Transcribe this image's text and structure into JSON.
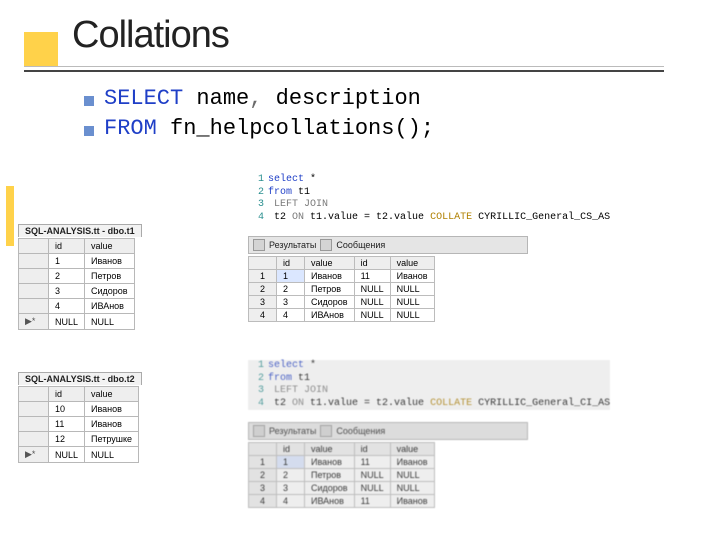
{
  "title": "Collations",
  "code": {
    "l1_kw": "SELECT",
    "l1_rest": " name",
    "l1_punct": ",",
    "l1_desc": " description",
    "l2_kw": "FROM",
    "l2_rest": " fn_helpcollations();"
  },
  "table1": {
    "tab": "SQL-ANALYSIS.tt - dbo.t1",
    "cols": [
      "id",
      "value"
    ],
    "rows": [
      [
        "1",
        "Иванов"
      ],
      [
        "2",
        "Петров"
      ],
      [
        "3",
        "Сидоров"
      ],
      [
        "4",
        "ИВАнов"
      ],
      [
        "NULL",
        "NULL"
      ]
    ],
    "star": "▶*"
  },
  "table2": {
    "tab": "SQL-ANALYSIS.tt - dbo.t2",
    "cols": [
      "id",
      "value"
    ],
    "rows": [
      [
        "10",
        "Иванов"
      ],
      [
        "11",
        "Иванов"
      ],
      [
        "12",
        "Петрушке"
      ],
      [
        "NULL",
        "NULL"
      ]
    ],
    "star": "▶*"
  },
  "sql1": {
    "lines": [
      {
        "ln": "1",
        "a": "select",
        "b": " *"
      },
      {
        "ln": "2",
        "a": "from",
        "b": " t1"
      },
      {
        "ln": "3",
        "a": "    LEFT JOIN",
        "b": ""
      },
      {
        "ln": "4",
        "a": "    t2 ",
        "b": "ON",
        "c": " t1.value = t2.value ",
        "d": "COLLATE",
        "e": " CYRILLIC_General_CS_AS"
      }
    ]
  },
  "resultTabs": {
    "a": "Результаты",
    "b": "Сообщения"
  },
  "result1": {
    "cols": [
      "id",
      "value",
      "id",
      "value"
    ],
    "rows": [
      [
        "1",
        "1",
        "Иванов",
        "11",
        "Иванов"
      ],
      [
        "2",
        "2",
        "Петров",
        "NULL",
        "NULL"
      ],
      [
        "3",
        "3",
        "Сидоров",
        "NULL",
        "NULL"
      ],
      [
        "4",
        "4",
        "ИВАнов",
        "NULL",
        "NULL"
      ]
    ]
  },
  "sql2": {
    "lines": [
      {
        "ln": "1",
        "a": "select",
        "b": " *"
      },
      {
        "ln": "2",
        "a": "from",
        "b": " t1"
      },
      {
        "ln": "3",
        "a": "    LEFT JOIN",
        "b": ""
      },
      {
        "ln": "4",
        "a": "    t2 ",
        "b": "ON",
        "c": " t1.value = t2.value ",
        "d": "COLLATE",
        "e": " CYRILLIC_General_CI_AS"
      }
    ]
  },
  "result2": {
    "cols": [
      "id",
      "value",
      "id",
      "value"
    ],
    "rows": [
      [
        "1",
        "1",
        "Иванов",
        "11",
        "Иванов"
      ],
      [
        "2",
        "2",
        "Петров",
        "NULL",
        "NULL"
      ],
      [
        "3",
        "3",
        "Сидоров",
        "NULL",
        "NULL"
      ],
      [
        "4",
        "4",
        "ИВАнов",
        "11",
        "Иванов"
      ]
    ]
  }
}
